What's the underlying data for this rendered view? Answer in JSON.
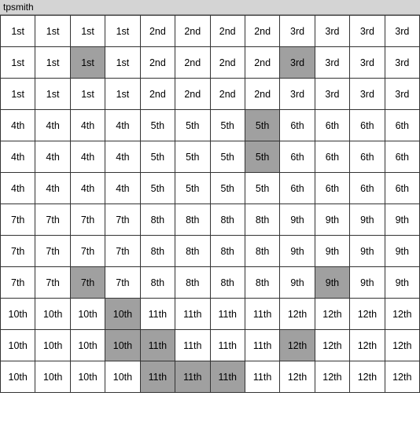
{
  "title": "tpsmith",
  "grid": {
    "rows": [
      [
        {
          "text": "1st",
          "h": false
        },
        {
          "text": "1st",
          "h": false
        },
        {
          "text": "1st",
          "h": false
        },
        {
          "text": "1st",
          "h": false
        },
        {
          "text": "2nd",
          "h": false
        },
        {
          "text": "2nd",
          "h": false
        },
        {
          "text": "2nd",
          "h": false
        },
        {
          "text": "2nd",
          "h": false
        },
        {
          "text": "3rd",
          "h": false
        },
        {
          "text": "3rd",
          "h": false
        },
        {
          "text": "3rd",
          "h": false
        },
        {
          "text": "3rd",
          "h": false
        }
      ],
      [
        {
          "text": "1st",
          "h": false
        },
        {
          "text": "1st",
          "h": false
        },
        {
          "text": "1st",
          "h": true
        },
        {
          "text": "1st",
          "h": false
        },
        {
          "text": "2nd",
          "h": false
        },
        {
          "text": "2nd",
          "h": false
        },
        {
          "text": "2nd",
          "h": false
        },
        {
          "text": "2nd",
          "h": false
        },
        {
          "text": "3rd",
          "h": true
        },
        {
          "text": "3rd",
          "h": false
        },
        {
          "text": "3rd",
          "h": false
        },
        {
          "text": "3rd",
          "h": false
        }
      ],
      [
        {
          "text": "1st",
          "h": false
        },
        {
          "text": "1st",
          "h": false
        },
        {
          "text": "1st",
          "h": false
        },
        {
          "text": "1st",
          "h": false
        },
        {
          "text": "2nd",
          "h": false
        },
        {
          "text": "2nd",
          "h": false
        },
        {
          "text": "2nd",
          "h": false
        },
        {
          "text": "2nd",
          "h": false
        },
        {
          "text": "3rd",
          "h": false
        },
        {
          "text": "3rd",
          "h": false
        },
        {
          "text": "3rd",
          "h": false
        },
        {
          "text": "3rd",
          "h": false
        }
      ],
      [
        {
          "text": "4th",
          "h": false
        },
        {
          "text": "4th",
          "h": false
        },
        {
          "text": "4th",
          "h": false
        },
        {
          "text": "4th",
          "h": false
        },
        {
          "text": "5th",
          "h": false
        },
        {
          "text": "5th",
          "h": false
        },
        {
          "text": "5th",
          "h": false
        },
        {
          "text": "5th",
          "h": true
        },
        {
          "text": "6th",
          "h": false
        },
        {
          "text": "6th",
          "h": false
        },
        {
          "text": "6th",
          "h": false
        },
        {
          "text": "6th",
          "h": false
        }
      ],
      [
        {
          "text": "4th",
          "h": false
        },
        {
          "text": "4th",
          "h": false
        },
        {
          "text": "4th",
          "h": false
        },
        {
          "text": "4th",
          "h": false
        },
        {
          "text": "5th",
          "h": false
        },
        {
          "text": "5th",
          "h": false
        },
        {
          "text": "5th",
          "h": false
        },
        {
          "text": "5th",
          "h": true
        },
        {
          "text": "6th",
          "h": false
        },
        {
          "text": "6th",
          "h": false
        },
        {
          "text": "6th",
          "h": false
        },
        {
          "text": "6th",
          "h": false
        }
      ],
      [
        {
          "text": "4th",
          "h": false
        },
        {
          "text": "4th",
          "h": false
        },
        {
          "text": "4th",
          "h": false
        },
        {
          "text": "4th",
          "h": false
        },
        {
          "text": "5th",
          "h": false
        },
        {
          "text": "5th",
          "h": false
        },
        {
          "text": "5th",
          "h": false
        },
        {
          "text": "5th",
          "h": false
        },
        {
          "text": "6th",
          "h": false
        },
        {
          "text": "6th",
          "h": false
        },
        {
          "text": "6th",
          "h": false
        },
        {
          "text": "6th",
          "h": false
        }
      ],
      [
        {
          "text": "7th",
          "h": false
        },
        {
          "text": "7th",
          "h": false
        },
        {
          "text": "7th",
          "h": false
        },
        {
          "text": "7th",
          "h": false
        },
        {
          "text": "8th",
          "h": false
        },
        {
          "text": "8th",
          "h": false
        },
        {
          "text": "8th",
          "h": false
        },
        {
          "text": "8th",
          "h": false
        },
        {
          "text": "9th",
          "h": false
        },
        {
          "text": "9th",
          "h": false
        },
        {
          "text": "9th",
          "h": false
        },
        {
          "text": "9th",
          "h": false
        }
      ],
      [
        {
          "text": "7th",
          "h": false
        },
        {
          "text": "7th",
          "h": false
        },
        {
          "text": "7th",
          "h": false
        },
        {
          "text": "7th",
          "h": false
        },
        {
          "text": "8th",
          "h": false
        },
        {
          "text": "8th",
          "h": false
        },
        {
          "text": "8th",
          "h": false
        },
        {
          "text": "8th",
          "h": false
        },
        {
          "text": "9th",
          "h": false
        },
        {
          "text": "9th",
          "h": false
        },
        {
          "text": "9th",
          "h": false
        },
        {
          "text": "9th",
          "h": false
        }
      ],
      [
        {
          "text": "7th",
          "h": false
        },
        {
          "text": "7th",
          "h": false
        },
        {
          "text": "7th",
          "h": true
        },
        {
          "text": "7th",
          "h": false
        },
        {
          "text": "8th",
          "h": false
        },
        {
          "text": "8th",
          "h": false
        },
        {
          "text": "8th",
          "h": false
        },
        {
          "text": "8th",
          "h": false
        },
        {
          "text": "9th",
          "h": false
        },
        {
          "text": "9th",
          "h": true
        },
        {
          "text": "9th",
          "h": false
        },
        {
          "text": "9th",
          "h": false
        }
      ],
      [
        {
          "text": "10th",
          "h": false
        },
        {
          "text": "10th",
          "h": false
        },
        {
          "text": "10th",
          "h": false
        },
        {
          "text": "10th",
          "h": true
        },
        {
          "text": "11th",
          "h": false
        },
        {
          "text": "11th",
          "h": false
        },
        {
          "text": "11th",
          "h": false
        },
        {
          "text": "11th",
          "h": false
        },
        {
          "text": "12th",
          "h": false
        },
        {
          "text": "12th",
          "h": false
        },
        {
          "text": "12th",
          "h": false
        },
        {
          "text": "12th",
          "h": false
        }
      ],
      [
        {
          "text": "10th",
          "h": false
        },
        {
          "text": "10th",
          "h": false
        },
        {
          "text": "10th",
          "h": false
        },
        {
          "text": "10th",
          "h": true
        },
        {
          "text": "11th",
          "h": true
        },
        {
          "text": "11th",
          "h": false
        },
        {
          "text": "11th",
          "h": false
        },
        {
          "text": "11th",
          "h": false
        },
        {
          "text": "12th",
          "h": true
        },
        {
          "text": "12th",
          "h": false
        },
        {
          "text": "12th",
          "h": false
        },
        {
          "text": "12th",
          "h": false
        }
      ],
      [
        {
          "text": "10th",
          "h": false
        },
        {
          "text": "10th",
          "h": false
        },
        {
          "text": "10th",
          "h": false
        },
        {
          "text": "10th",
          "h": false
        },
        {
          "text": "11th",
          "h": true
        },
        {
          "text": "11th",
          "h": true
        },
        {
          "text": "11th",
          "h": true
        },
        {
          "text": "11th",
          "h": false
        },
        {
          "text": "12th",
          "h": false
        },
        {
          "text": "12th",
          "h": false
        },
        {
          "text": "12th",
          "h": false
        },
        {
          "text": "12th",
          "h": false
        }
      ]
    ]
  }
}
